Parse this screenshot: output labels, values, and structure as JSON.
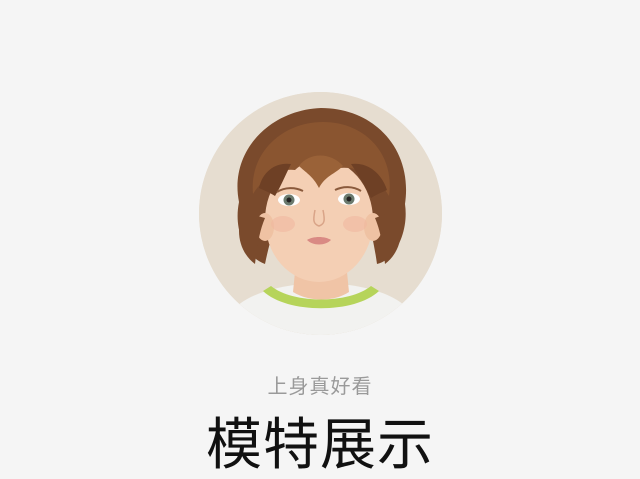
{
  "section": {
    "subtitle": "上身真好看",
    "title": "模特展示"
  },
  "avatar": {
    "alt": "model-photo"
  },
  "colors": {
    "background": "#f5f5f5",
    "subtitle": "#9a9a9a",
    "title": "#111111",
    "photo_background": "#e8dfd3",
    "shirt_collar": "#b6d45a"
  }
}
